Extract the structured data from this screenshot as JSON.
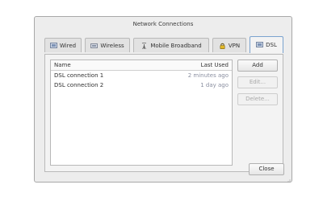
{
  "window": {
    "title": "Network Connections"
  },
  "tabs": [
    {
      "label": "Wired",
      "icon": "wired-icon",
      "active": false
    },
    {
      "label": "Wireless",
      "icon": "wireless-icon",
      "active": false
    },
    {
      "label": "Mobile Broadband",
      "icon": "mobile-broadband-icon",
      "active": false
    },
    {
      "label": "VPN",
      "icon": "vpn-lock-icon",
      "active": false
    },
    {
      "label": "DSL",
      "icon": "dsl-icon",
      "active": true
    }
  ],
  "list": {
    "columns": {
      "name": "Name",
      "last_used": "Last Used"
    },
    "rows": [
      {
        "name": "DSL connection 1",
        "last_used": "2 minutes ago"
      },
      {
        "name": "DSL connection 2",
        "last_used": "1 day ago"
      }
    ]
  },
  "buttons": {
    "add": "Add",
    "edit": "Edit...",
    "delete": "Delete...",
    "close": "Close"
  },
  "colors": {
    "active_tab_border": "#7aa3cf",
    "muted_text": "#8a8fa0"
  }
}
